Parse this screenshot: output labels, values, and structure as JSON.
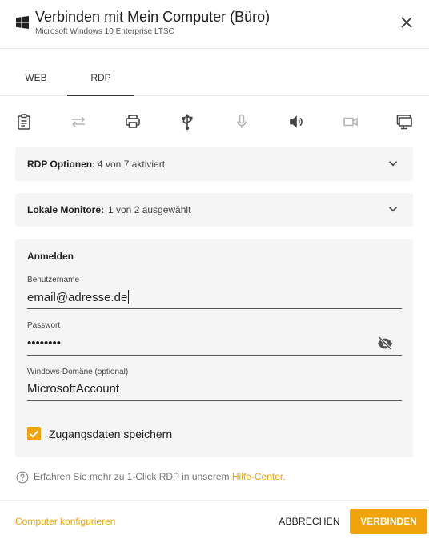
{
  "colors": {
    "accent": "#f0a30a",
    "panel_bg": "#f5f5f5"
  },
  "header": {
    "title": "Verbinden mit Mein Computer (Büro)",
    "subtitle": "Microsoft Windows 10 Enterprise LTSC",
    "icon": "windows-logo-icon",
    "close_icon": "close-icon"
  },
  "tabs": [
    {
      "label": "WEB",
      "active": false
    },
    {
      "label": "RDP",
      "active": true
    }
  ],
  "toolbar_icons": [
    {
      "name": "clipboard-icon",
      "enabled": true
    },
    {
      "name": "file-transfer-icon",
      "enabled": false
    },
    {
      "name": "printer-icon",
      "enabled": true
    },
    {
      "name": "usb-icon",
      "enabled": true
    },
    {
      "name": "microphone-icon",
      "enabled": false
    },
    {
      "name": "speaker-icon",
      "enabled": true
    },
    {
      "name": "camera-icon",
      "enabled": false
    },
    {
      "name": "monitors-icon",
      "enabled": true
    }
  ],
  "rdp_options": {
    "label": "RDP Optionen:",
    "value": "4 von 7 aktiviert"
  },
  "monitors": {
    "label": "Lokale Monitore:",
    "value": "1 von 2 ausgewählt"
  },
  "login": {
    "heading": "Anmelden",
    "username_label": "Benutzername",
    "username_value": "email@adresse.de",
    "password_label": "Passwort",
    "password_value": "••••••••",
    "domain_label": "Windows-Domäne (optional)",
    "domain_value": "MicrosoftAccount",
    "save_credentials_label": "Zugangsdaten speichern",
    "save_credentials_checked": true
  },
  "help": {
    "text": "Erfahren Sie mehr zu 1-Click RDP in unserem ",
    "link": "Hilfe-Center."
  },
  "footer": {
    "configure_label": "Computer konfigurieren",
    "cancel_label": "ABBRECHEN",
    "connect_label": "VERBINDEN"
  }
}
